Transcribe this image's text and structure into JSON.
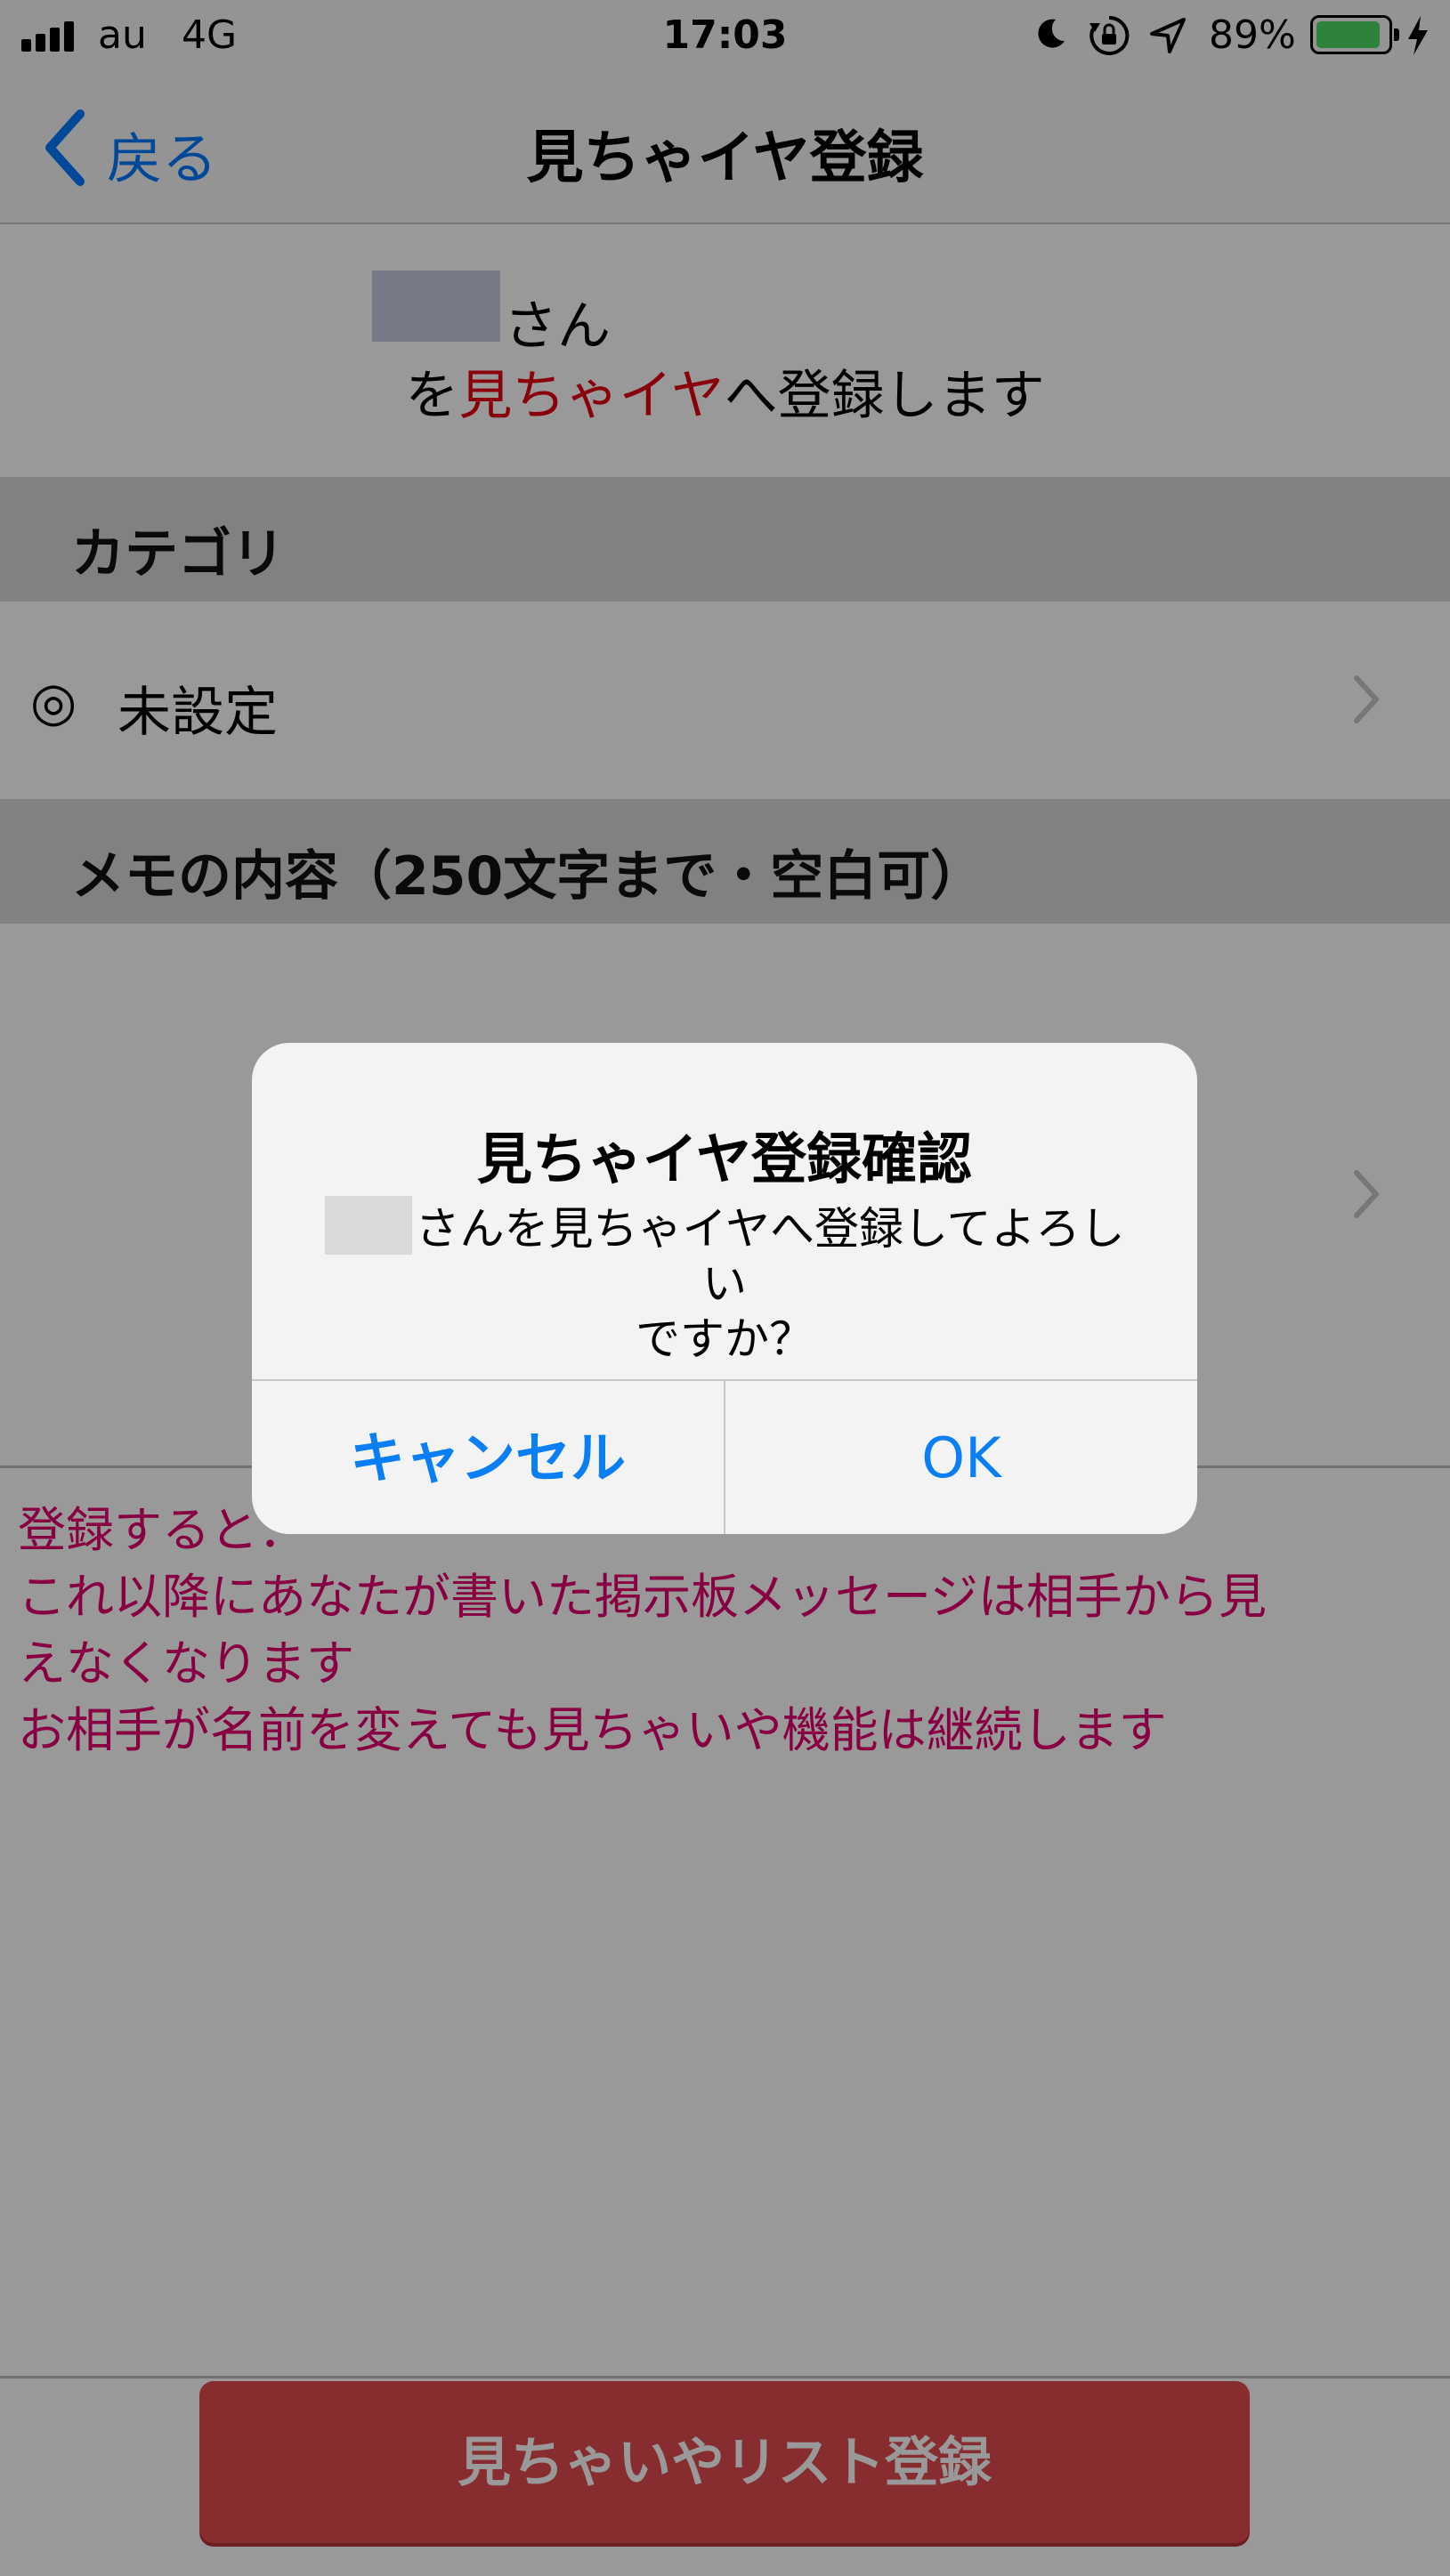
{
  "status_bar": {
    "carrier": "au",
    "network": "4G",
    "time": "17:03",
    "battery_percent": "89%",
    "battery_level": 0.89,
    "icons": [
      "signal-icon",
      "moon-icon",
      "rotation-lock-icon",
      "location-arrow-icon",
      "battery-icon",
      "charging-bolt-icon"
    ]
  },
  "nav": {
    "back_label": "戻る",
    "title": "見ちゃイヤ登録"
  },
  "user_block": {
    "suffix": "さん",
    "line2_pre": "を",
    "line2_highlight": "見ちゃイヤ",
    "line2_post": "へ登録します"
  },
  "category": {
    "header": "カテゴリ",
    "icon_glyph": "◎",
    "value": "未設定"
  },
  "memo": {
    "header": "メモの内容（250文字まで・空白可）"
  },
  "notice": {
    "lines": [
      "登録すると：",
      "これ以降にあなたが書いた掲示板メッセージは相手から見",
      "えなくなります",
      "お相手が名前を変えても見ちゃいや機能は継続します"
    ]
  },
  "register_button": {
    "label": "見ちゃいやリスト登録"
  },
  "alert": {
    "title": "見ちゃイヤ登録確認",
    "message_line1": "さんを見ちゃイヤへ登録してよろしい",
    "message_line2": "ですか？",
    "cancel_label": "キャンセル",
    "ok_label": "OK"
  },
  "colors": {
    "accent_blue": "#007aff",
    "highlight_red": "#e60012",
    "notice_pink": "#e4006e",
    "button_red": "#e24a4f",
    "battery_green": "#4cd964"
  }
}
